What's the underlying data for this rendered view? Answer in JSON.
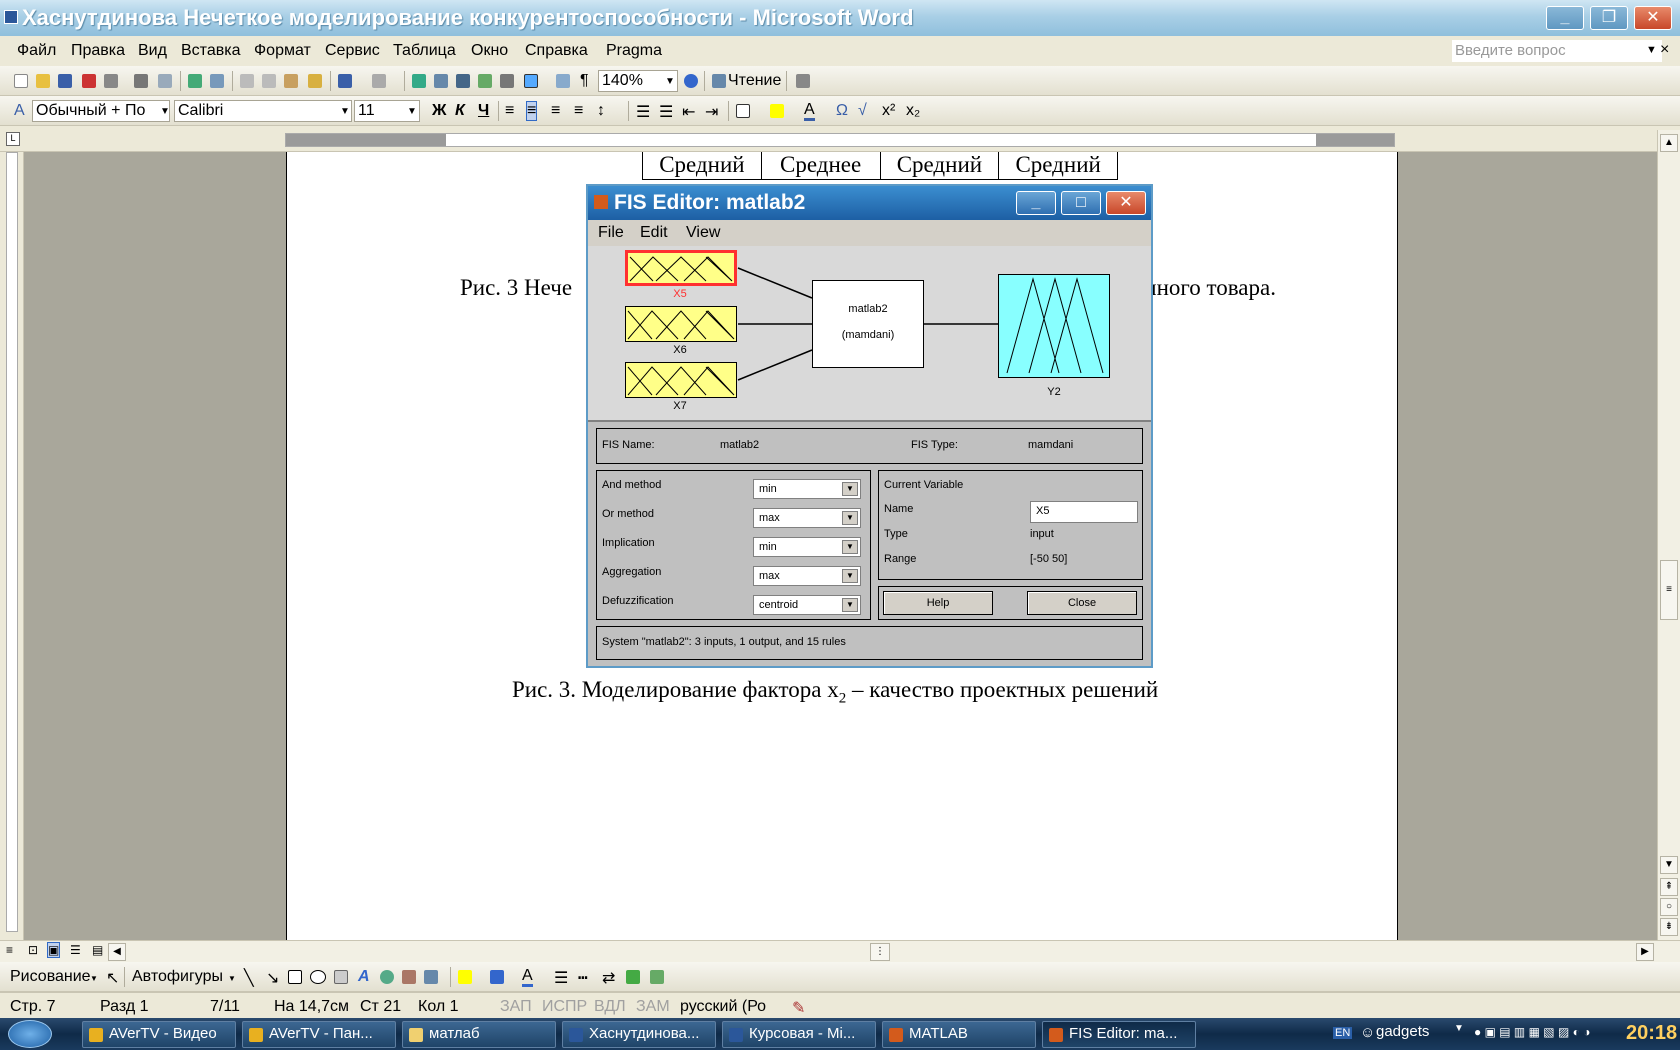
{
  "window": {
    "title": "Хаснутдинова Нечеткое моделирование конкурентоспособности - Microsoft Word",
    "minimize": "_",
    "restore": "❐",
    "close": "✕"
  },
  "menu": {
    "items": [
      "Файл",
      "Правка",
      "Вид",
      "Вставка",
      "Формат",
      "Сервис",
      "Таблица",
      "Окно",
      "Справка",
      "Pragma"
    ],
    "ask_placeholder": "Введите вопрос",
    "doc_close": "×"
  },
  "toolbar": {
    "zoom": "140%",
    "reading": "Чтение",
    "style": "Обычный + По",
    "font": "Calibri",
    "size": "11",
    "bold": "Ж",
    "italic": "К",
    "underline": "Ч",
    "omega": "Ω",
    "superscript": "x²",
    "subscript": "x₂"
  },
  "document": {
    "table_row": [
      "Средний",
      "Среднее",
      "Средний",
      "Средний"
    ],
    "caption1_start": "Рис. 3 Нече",
    "caption1_end": "чного товара.",
    "caption2_main": "Рис. 3. Моделирование фактора x",
    "caption2_sub": "2",
    "caption2_rest": " – качество проектных решений"
  },
  "fis_editor": {
    "title": "FIS Editor: matlab2",
    "menu": [
      "File",
      "Edit",
      "View"
    ],
    "inputs": [
      "X5",
      "X6",
      "X7"
    ],
    "selected_input": "X5",
    "system_name": "matlab2",
    "system_type_label": "(mamdani)",
    "output": "Y2",
    "fis_name_label": "FIS Name:",
    "fis_name": "matlab2",
    "fis_type_label": "FIS Type:",
    "fis_type": "mamdani",
    "methods": [
      {
        "label": "And method",
        "value": "min"
      },
      {
        "label": "Or method",
        "value": "max"
      },
      {
        "label": "Implication",
        "value": "min"
      },
      {
        "label": "Aggregation",
        "value": "max"
      },
      {
        "label": "Defuzzification",
        "value": "centroid"
      }
    ],
    "current_variable_label": "Current Variable",
    "name_label": "Name",
    "name_value": "X5",
    "type_label": "Type",
    "type_value": "input",
    "range_label": "Range",
    "range_value": "[-50 50]",
    "help": "Help",
    "close": "Close",
    "status": "System \"matlab2\": 3 inputs, 1 output, and 15 rules",
    "colors": {
      "input": "#ffff88",
      "output": "#88ffff",
      "selected": "#ff3030"
    }
  },
  "drawbar": {
    "drawing": "Рисование",
    "autoshapes": "Автофигуры"
  },
  "status": {
    "page": "Стр. 7",
    "section": "Разд 1",
    "pages": "7/11",
    "at": "На 14,7см",
    "line": "Ст 21",
    "col": "Кол 1",
    "rec": "ЗАП",
    "trk": "ИСПР",
    "ext": "ВДЛ",
    "ovr": "ЗАМ",
    "lang": "русский (Ро"
  },
  "taskbar": {
    "tasks": [
      {
        "label": "AVerTV - Видео",
        "color": "#e8b020"
      },
      {
        "label": "AVerTV - Пан...",
        "color": "#e8b020"
      },
      {
        "label": "матлаб",
        "color": "#f0d070"
      },
      {
        "label": "Хаснутдинова...",
        "color": "#2b579a"
      },
      {
        "label": "Курсовая - Mi...",
        "color": "#2b579a"
      },
      {
        "label": "MATLAB",
        "color": "#d35b1c"
      },
      {
        "label": "FIS Editor: ma...",
        "color": "#d35b1c"
      }
    ],
    "lang": "EN",
    "gadgets": "gadgets",
    "clock": "20:18"
  }
}
